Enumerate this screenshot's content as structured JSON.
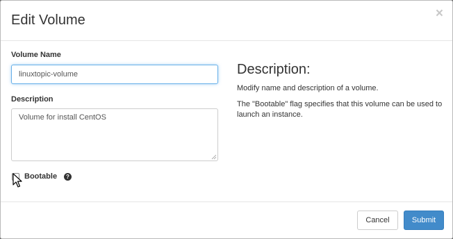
{
  "modal": {
    "title": "Edit Volume",
    "close_symbol": "×"
  },
  "form": {
    "volume_name_label": "Volume Name",
    "volume_name_value": "linuxtopic-volume",
    "description_label": "Description",
    "description_value": "Volume for install CentOS",
    "bootable_label": "Bootable",
    "bootable_checked": false,
    "help_symbol": "?"
  },
  "help_panel": {
    "heading": "Description:",
    "paragraphs": [
      "Modify name and description of a volume.",
      "The \"Bootable\" flag specifies that this volume can be used to launch an instance."
    ]
  },
  "footer": {
    "cancel_label": "Cancel",
    "submit_label": "Submit"
  },
  "colors": {
    "primary": "#428bca",
    "focus_border": "#66afe9"
  },
  "icons": [
    "close-icon",
    "help-icon",
    "mouse-pointer-icon"
  ]
}
